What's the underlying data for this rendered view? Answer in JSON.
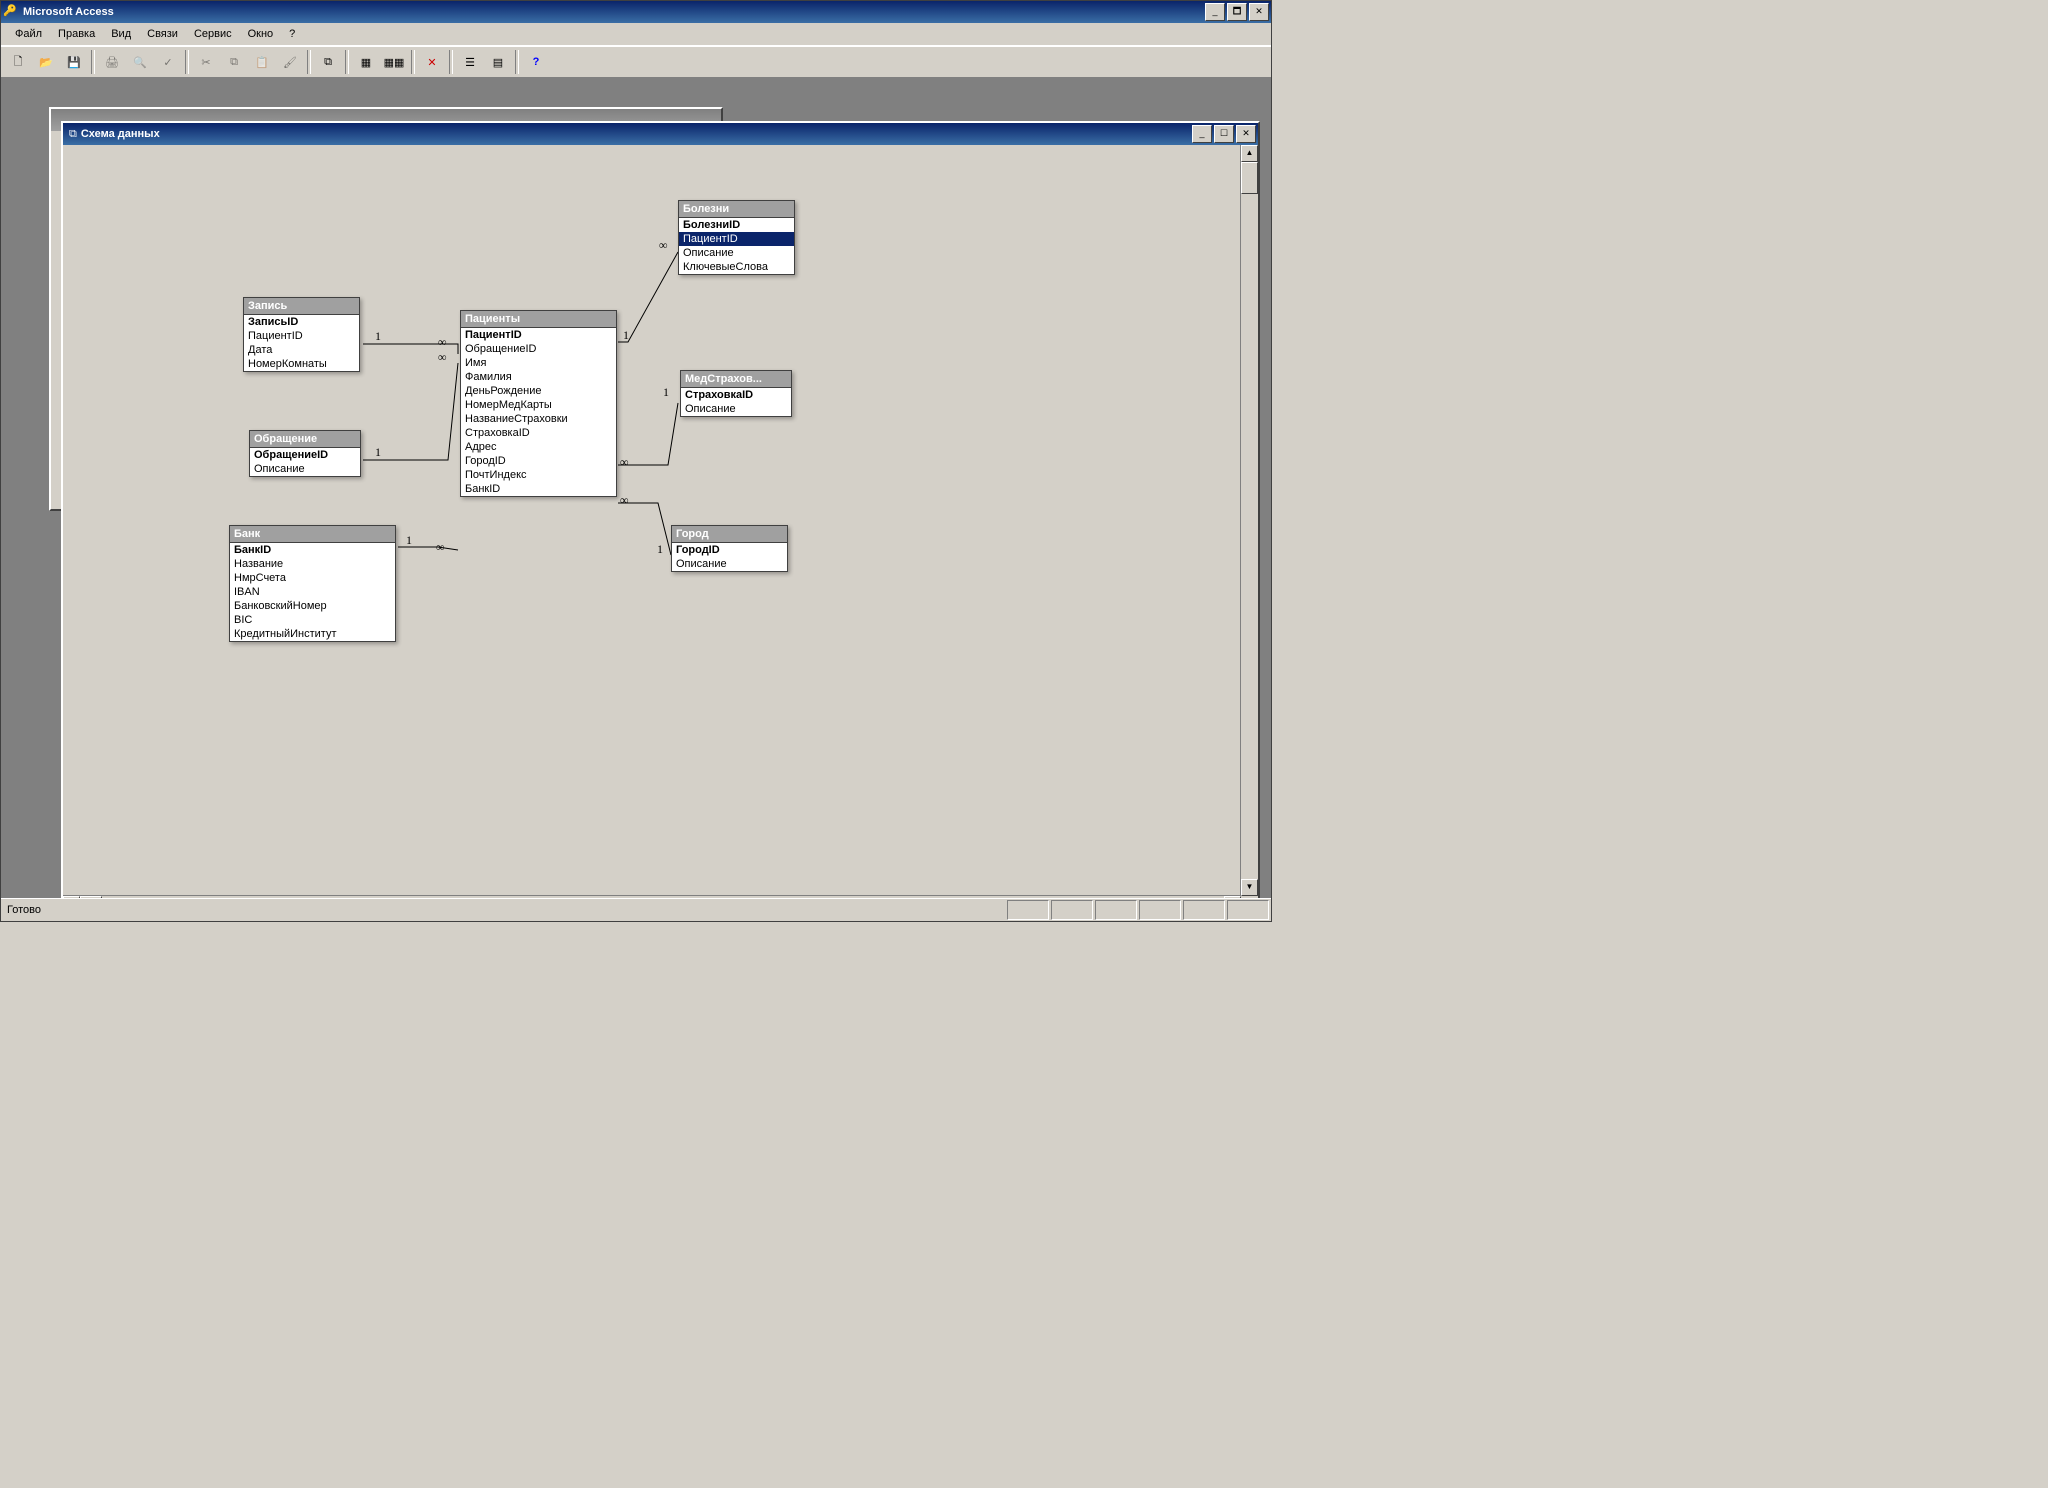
{
  "app_title": "Microsoft Access",
  "menus": [
    "Файл",
    "Правка",
    "Вид",
    "Связи",
    "Сервис",
    "Окно",
    "?"
  ],
  "child_window_title": "Схема данных",
  "status_text": "Готово",
  "relation_symbols": {
    "one": "1",
    "many": "∞"
  },
  "tables": {
    "zapis": {
      "title": "Запись",
      "fields": [
        {
          "n": "ЗаписьID",
          "pk": true
        },
        {
          "n": "ПациентID"
        },
        {
          "n": "Дата"
        },
        {
          "n": "НомерКомнаты"
        }
      ]
    },
    "obrash": {
      "title": "Обращение",
      "fields": [
        {
          "n": "ОбращениеID",
          "pk": true
        },
        {
          "n": "Описание"
        }
      ]
    },
    "bank": {
      "title": "Банк",
      "fields": [
        {
          "n": "БанкID",
          "pk": true
        },
        {
          "n": "Название"
        },
        {
          "n": "НмрСчета"
        },
        {
          "n": "IBAN"
        },
        {
          "n": "БанковскийНомер"
        },
        {
          "n": "BIC"
        },
        {
          "n": "КредитныйИнститут"
        }
      ]
    },
    "patients": {
      "title": "Пациенты",
      "fields": [
        {
          "n": "ПациентID",
          "pk": true
        },
        {
          "n": "ОбращениеID"
        },
        {
          "n": "Имя"
        },
        {
          "n": "Фамилия"
        },
        {
          "n": "ДеньРождение"
        },
        {
          "n": "НомерМедКарты"
        },
        {
          "n": "НазваниеСтраховки"
        },
        {
          "n": "СтраховкаID"
        },
        {
          "n": "Адрес"
        },
        {
          "n": "ГородID"
        },
        {
          "n": "ПочтИндекс"
        },
        {
          "n": "БанкID"
        }
      ]
    },
    "bolezni": {
      "title": "Болезни",
      "fields": [
        {
          "n": "БолезниID",
          "pk": true
        },
        {
          "n": "ПациентID",
          "sel": true
        },
        {
          "n": "Описание"
        },
        {
          "n": "КлючевыеСлова"
        }
      ]
    },
    "medstr": {
      "title": "МедСтрахов...",
      "fields": [
        {
          "n": "СтраховкаID",
          "pk": true
        },
        {
          "n": "Описание"
        }
      ]
    },
    "gorod": {
      "title": "Город",
      "fields": [
        {
          "n": "ГородID",
          "pk": true
        },
        {
          "n": "Описание"
        }
      ]
    }
  },
  "toolbar_icons": [
    "new",
    "open",
    "save",
    "|",
    "print",
    "preview",
    "spelling",
    "|",
    "cut",
    "copy",
    "paste",
    "format-painter",
    "|",
    "relationships",
    "|",
    "show-table",
    "show-all",
    "|",
    "delete",
    "|",
    "properties",
    "new-object",
    "|",
    "help"
  ]
}
